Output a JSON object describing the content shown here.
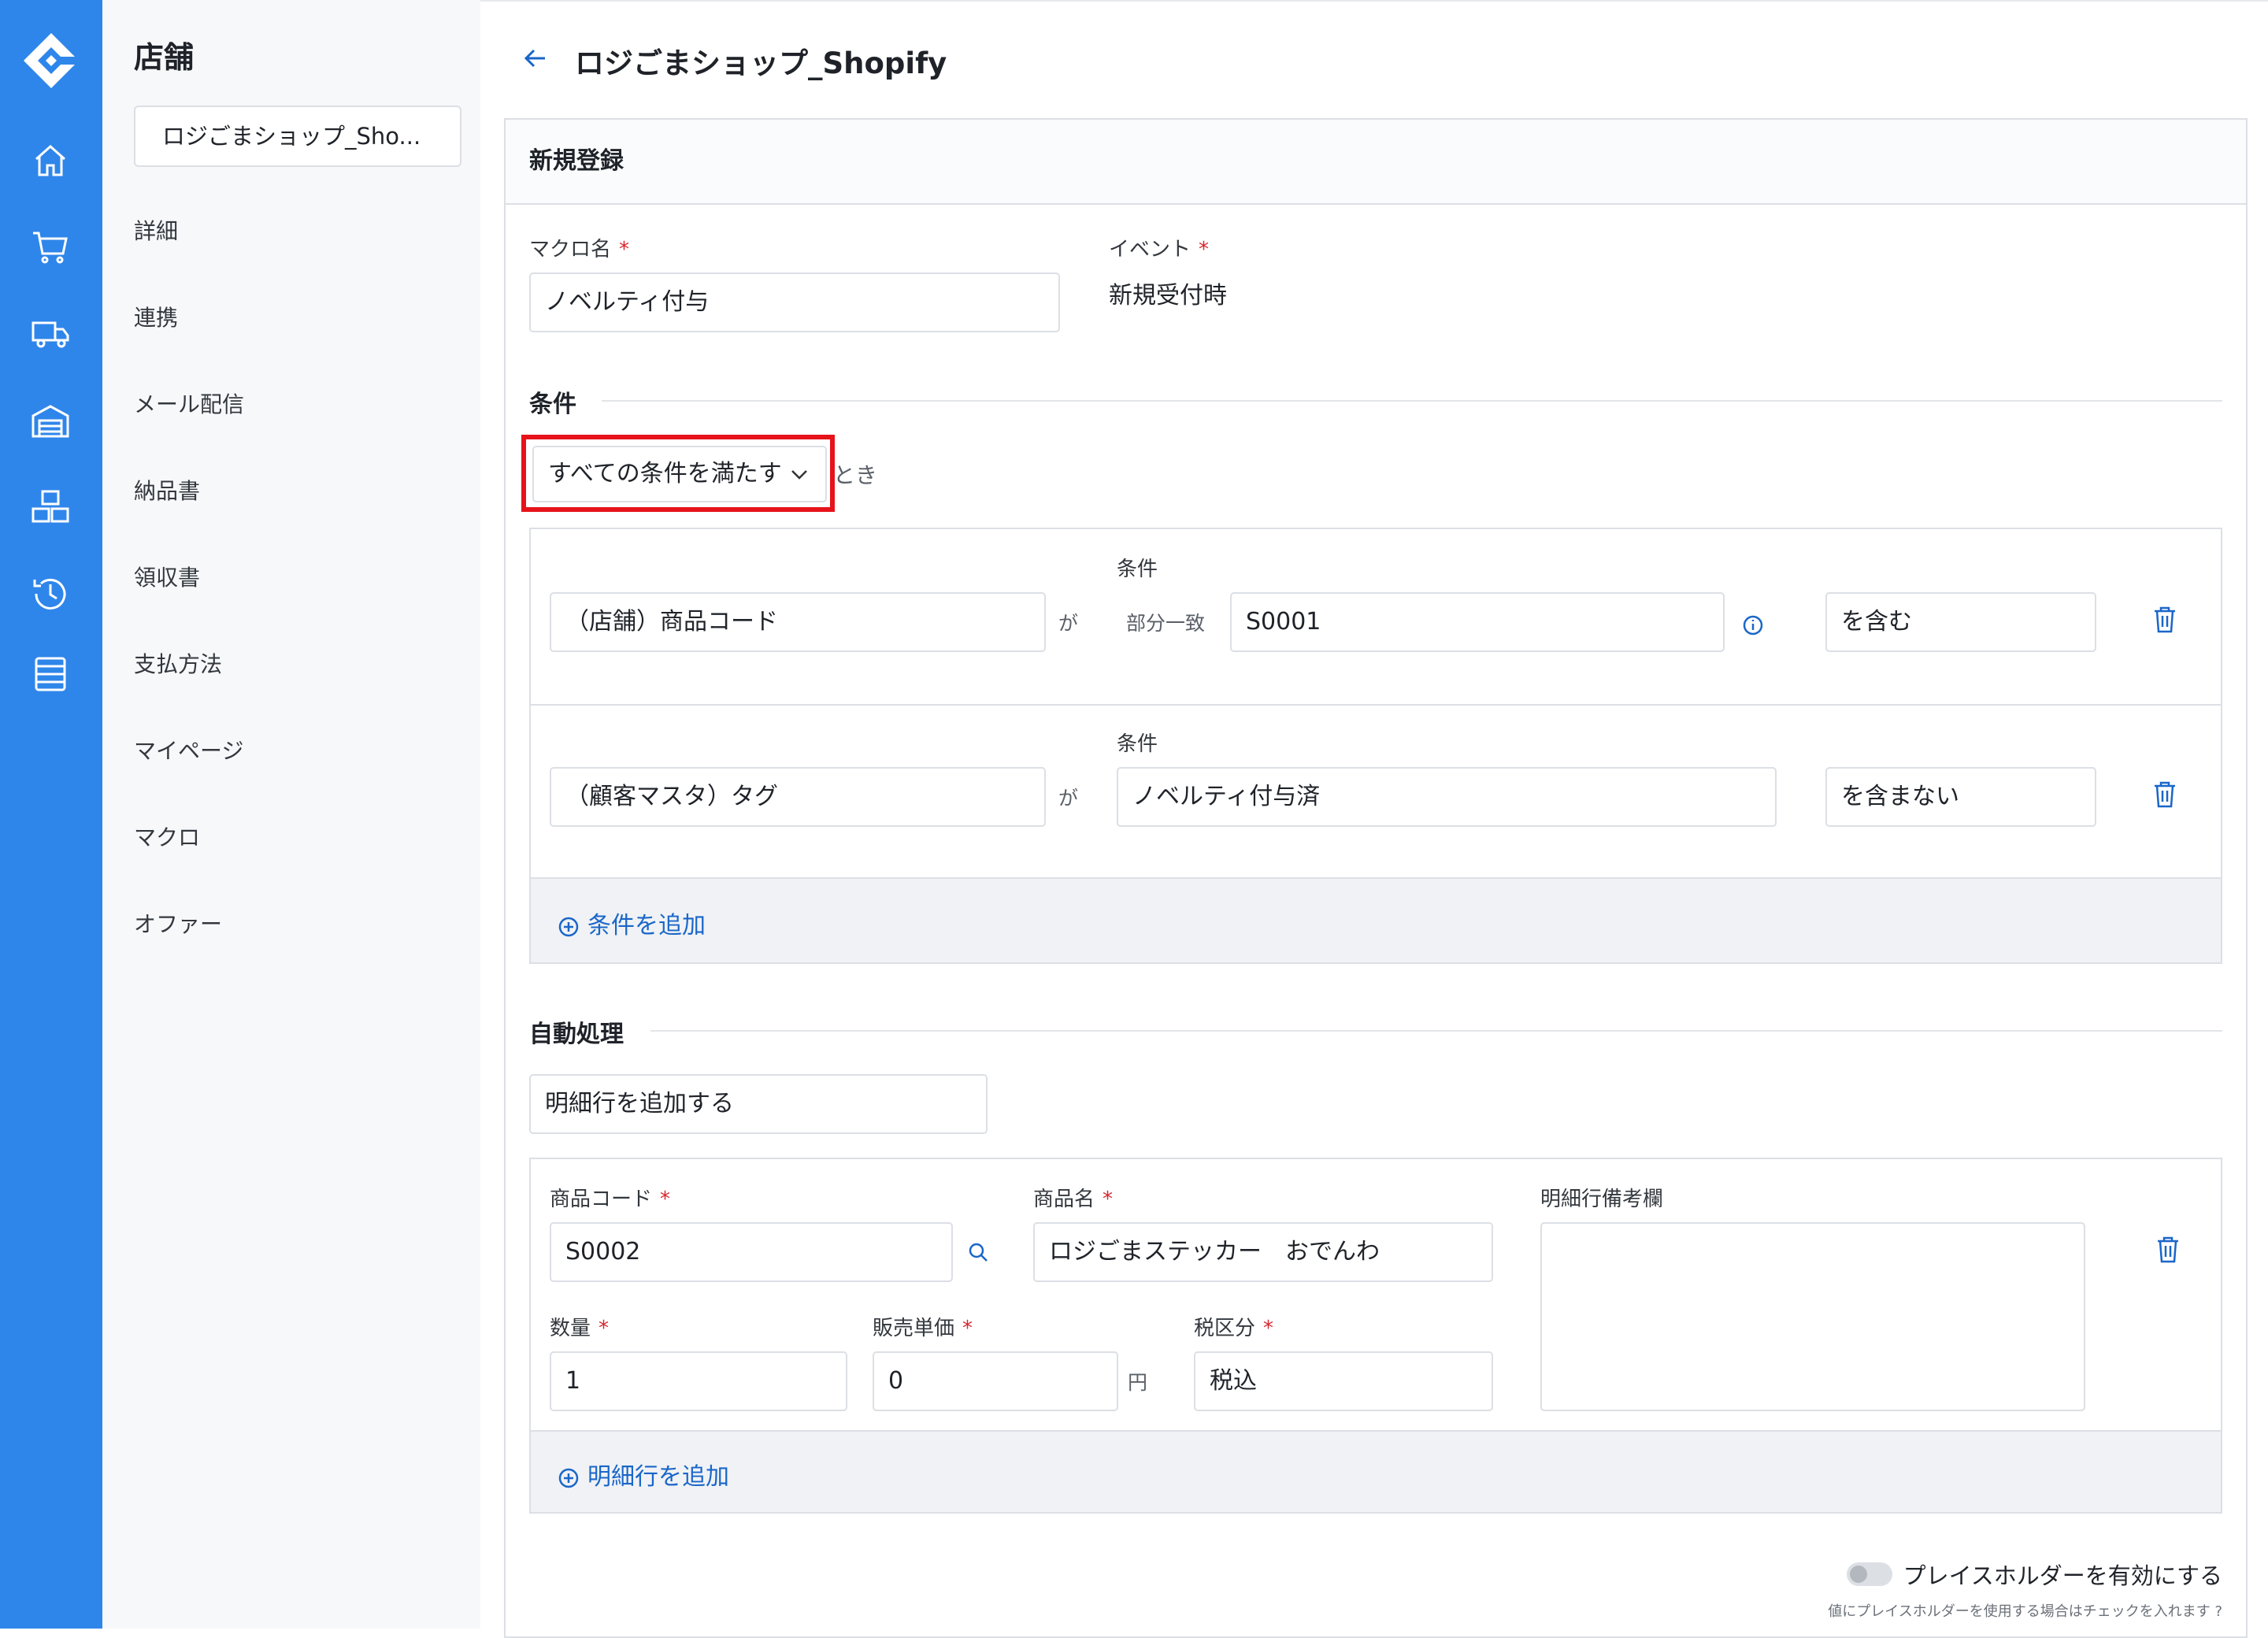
{
  "sidebar": {
    "title": "店舗",
    "store_select": "ロジごまショップ_Sho...",
    "items": [
      "詳細",
      "連携",
      "メール配信",
      "納品書",
      "領収書",
      "支払方法",
      "マイページ",
      "マクロ",
      "オファー"
    ]
  },
  "rail_icons": [
    "home-icon",
    "cart-icon",
    "truck-icon",
    "warehouse-icon",
    "boxes-icon",
    "history-icon",
    "list-icon"
  ],
  "header": {
    "title": "ロジごまショップ_Shopify"
  },
  "form": {
    "card_title": "新規登録",
    "macro_name_label": "マクロ名",
    "macro_name_value": "ノベルティ付与",
    "event_label": "イベント",
    "event_value": "新規受付時",
    "conditions_section": "条件",
    "match_select": "すべての条件を満たす",
    "match_suffix": "とき",
    "conditions": [
      {
        "cond_label": "条件",
        "field": "（店舗）商品コード",
        "ga": "が",
        "mode": "部分一致",
        "value": "S0001",
        "op": "を含む"
      },
      {
        "cond_label": "条件",
        "field": "（顧客マスタ）タグ",
        "ga": "が",
        "value": "ノベルティ付与済",
        "op": "を含まない"
      }
    ],
    "add_condition": "条件を追加",
    "auto_section": "自動処理",
    "action_select": "明細行を追加する",
    "line": {
      "code_label": "商品コード",
      "code_value": "S0002",
      "name_label": "商品名",
      "name_value": "ロジごまステッカー　おでんわ",
      "note_label": "明細行備考欄",
      "note_value": "",
      "qty_label": "数量",
      "qty_value": "1",
      "price_label": "販売単価",
      "price_value": "0",
      "price_unit": "円",
      "tax_label": "税区分",
      "tax_value": "税込"
    },
    "add_line": "明細行を追加",
    "placeholder_toggle": "プレイスホルダーを有効にする",
    "placeholder_hint": "値にプレイスホルダーを使用する場合はチェックを入れます"
  },
  "colors": {
    "rail": "#2f86ea",
    "link": "#1a66c9",
    "required": "#d8262e",
    "highlight": "#e6131b"
  }
}
